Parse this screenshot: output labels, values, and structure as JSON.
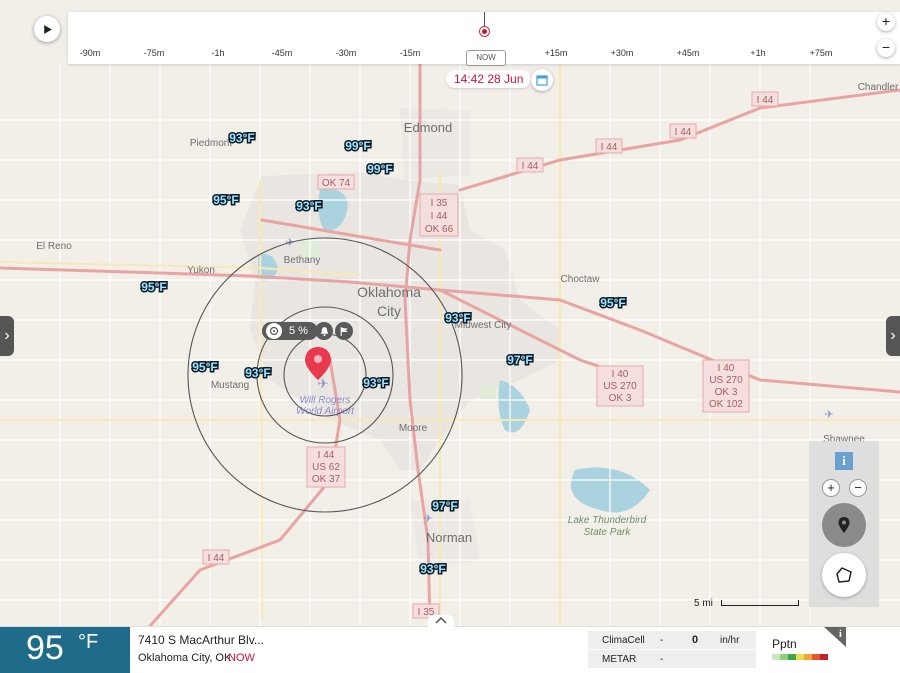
{
  "timeline": {
    "ticks": [
      "-90m",
      "-75m",
      "-1h",
      "-45m",
      "-30m",
      "-15m",
      "+15m",
      "+30m",
      "+45m",
      "+1h",
      "+75m"
    ],
    "now_label": "NOW",
    "zoom_in": "+",
    "zoom_out": "−",
    "current_datetime": "14:42 28 Jun"
  },
  "map": {
    "cities": [
      "Edmond",
      "Oklahoma",
      "City",
      "Norman",
      "Moore",
      "Bethany",
      "Yukon",
      "Mustang",
      "El Reno",
      "Piedmont",
      "Choctaw",
      "Midwest City",
      "Shawnee",
      "Chandler"
    ],
    "airport": [
      "Will Rogers",
      "World Airport"
    ],
    "lake": [
      "Lake Thunderbird",
      "State Park"
    ],
    "highways": [
      [
        "OK 74"
      ],
      [
        "I 35",
        "I 44",
        "OK 66"
      ],
      [
        "I 44"
      ],
      [
        "I 44"
      ],
      [
        "I 44"
      ],
      [
        "I 44"
      ],
      [
        "I 40",
        "US 270",
        "OK 3"
      ],
      [
        "I 40",
        "US 270",
        "OK 3",
        "OK 102"
      ],
      [
        "I 44",
        "US 62",
        "OK 37"
      ],
      [
        "I 44"
      ],
      [
        "I 35"
      ]
    ],
    "temperatures": [
      "93°F",
      "99°F",
      "99°F",
      "95°F",
      "93°F",
      "95°F",
      "93°F",
      "95°F",
      "95°F",
      "93°F",
      "93°F",
      "97°F",
      "97°F",
      "93°F"
    ],
    "ring_bubble_value": "5 %",
    "scale_label": "5 mi"
  },
  "bottom": {
    "temperature": "95",
    "unit": "°F",
    "address": "7410 S MacArthur Blv...",
    "city": "Oklahoma City, OK",
    "now": "NOW",
    "feeds": [
      {
        "name": "ClimaCell",
        "dash": "-",
        "value": "0",
        "unit": "in/hr"
      },
      {
        "name": "METAR",
        "dash": "-",
        "value": "",
        "unit": ""
      }
    ],
    "pptn_label": "Pptn"
  },
  "colors": {
    "accent_red": "#d0103a",
    "temp_box": "#1f6b8a",
    "highway": "#e8a3a3"
  }
}
